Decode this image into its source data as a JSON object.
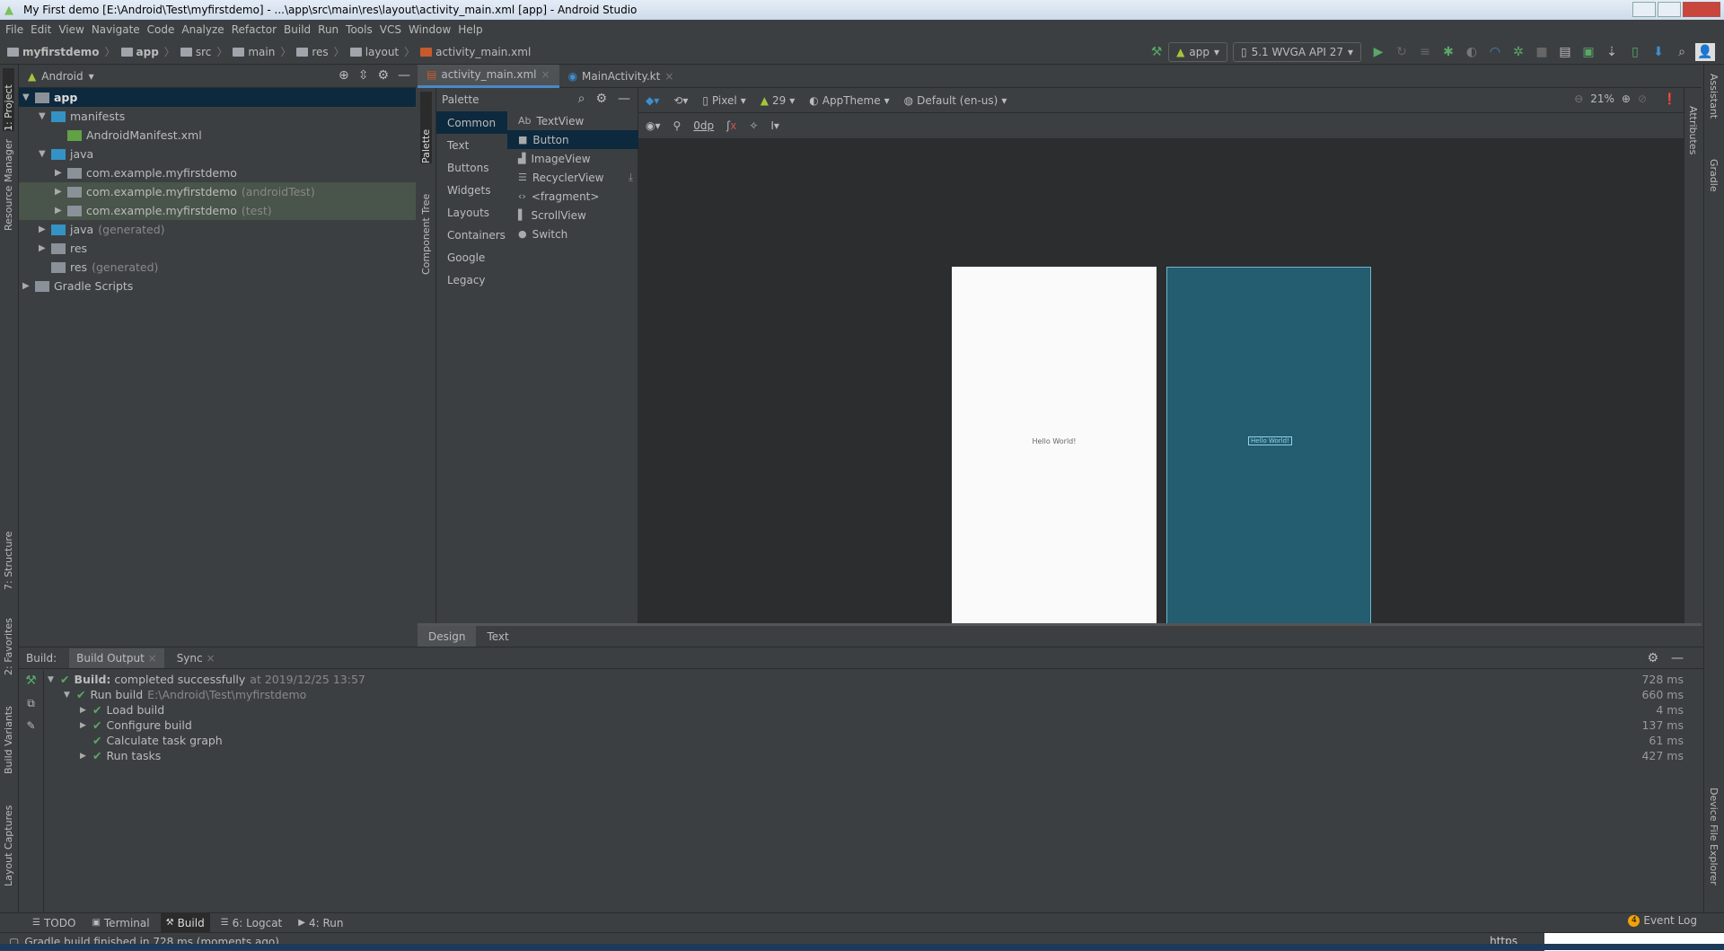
{
  "window": {
    "title": "My First demo [E:\\Android\\Test\\myfirstdemo] - ...\\app\\src\\main\\res\\layout\\activity_main.xml [app] - Android Studio"
  },
  "menu": [
    "File",
    "Edit",
    "View",
    "Navigate",
    "Code",
    "Analyze",
    "Refactor",
    "Build",
    "Run",
    "Tools",
    "VCS",
    "Window",
    "Help"
  ],
  "breadcrumb": [
    "myfirstdemo",
    "app",
    "src",
    "main",
    "res",
    "layout",
    "activity_main.xml"
  ],
  "toolbar": {
    "config": "app",
    "device": "5.1  WVGA API 27"
  },
  "left_strip": [
    "1: Project",
    "Resource Manager",
    "7: Structure",
    "2: Favorites",
    "Build Variants",
    "Layout Captures"
  ],
  "right_strip": [
    "Assistant",
    "Gradle",
    "Device File Explorer"
  ],
  "project": {
    "view": "Android",
    "tree": [
      {
        "label": "app",
        "extra": "",
        "depth": 0,
        "arrow": "down",
        "icon": "module",
        "bold": true,
        "selected": true
      },
      {
        "label": "manifests",
        "extra": "",
        "depth": 1,
        "arrow": "down",
        "icon": "folder"
      },
      {
        "label": "AndroidManifest.xml",
        "extra": "",
        "depth": 2,
        "arrow": "",
        "icon": "manifest"
      },
      {
        "label": "java",
        "extra": "",
        "depth": 1,
        "arrow": "down",
        "icon": "folder"
      },
      {
        "label": "com.example.myfirstdemo",
        "extra": "",
        "depth": 2,
        "arrow": "right",
        "icon": "package"
      },
      {
        "label": "com.example.myfirstdemo",
        "extra": "(androidTest)",
        "depth": 2,
        "arrow": "right",
        "icon": "package",
        "highlight": true
      },
      {
        "label": "com.example.myfirstdemo",
        "extra": "(test)",
        "depth": 2,
        "arrow": "right",
        "icon": "package",
        "highlight": true
      },
      {
        "label": "java",
        "extra": "(generated)",
        "depth": 1,
        "arrow": "right",
        "icon": "folder-gen"
      },
      {
        "label": "res",
        "extra": "",
        "depth": 1,
        "arrow": "right",
        "icon": "res"
      },
      {
        "label": "res",
        "extra": "(generated)",
        "depth": 1,
        "arrow": "",
        "icon": "res"
      },
      {
        "label": "Gradle Scripts",
        "extra": "",
        "depth": 0,
        "arrow": "right",
        "icon": "gradle"
      }
    ]
  },
  "editor": {
    "tabs": [
      {
        "label": "activity_main.xml",
        "active": true
      },
      {
        "label": "MainActivity.kt",
        "active": false
      }
    ],
    "side_tabs": [
      "Palette",
      "Component Tree"
    ],
    "attributes_tab": "Attributes",
    "palette": {
      "title": "Palette",
      "categories": [
        "Common",
        "Text",
        "Buttons",
        "Widgets",
        "Layouts",
        "Containers",
        "Google",
        "Legacy"
      ],
      "selected_category": "Common",
      "items": [
        {
          "label": "TextView",
          "icon": "Ab"
        },
        {
          "label": "Button",
          "icon": "button"
        },
        {
          "label": "ImageView",
          "icon": "image"
        },
        {
          "label": "RecyclerView",
          "icon": "list"
        },
        {
          "label": "<fragment>",
          "icon": "code"
        },
        {
          "label": "ScrollView",
          "icon": "scroll"
        },
        {
          "label": "Switch",
          "icon": "switch"
        }
      ],
      "selected_item": "Button"
    },
    "design_toolbar": {
      "device": "Pixel",
      "api": "29",
      "theme": "AppTheme",
      "locale": "Default (en-us)",
      "zoom": "21%",
      "margin": "0dp"
    },
    "preview_text": "Hello World!",
    "blueprint_text": "Hello World!",
    "bottom_tabs": [
      "Design",
      "Text"
    ],
    "active_bottom_tab": "Design"
  },
  "build": {
    "label": "Build:",
    "tabs": [
      "Build Output",
      "Sync"
    ],
    "rows": [
      {
        "text": "Build:",
        "rest": " completed successfully",
        "extra": "at 2019/12/25 13:57",
        "time": "728 ms",
        "depth": 0,
        "arrow": "down"
      },
      {
        "text": "Run build",
        "rest": "",
        "extra": "E:\\Android\\Test\\myfirstdemo",
        "time": "660 ms",
        "depth": 1,
        "arrow": "down"
      },
      {
        "text": "Load build",
        "rest": "",
        "extra": "",
        "time": "4 ms",
        "depth": 2,
        "arrow": "right"
      },
      {
        "text": "Configure build",
        "rest": "",
        "extra": "",
        "time": "137 ms",
        "depth": 2,
        "arrow": "right"
      },
      {
        "text": "Calculate task graph",
        "rest": "",
        "extra": "",
        "time": "61 ms",
        "depth": 2,
        "arrow": ""
      },
      {
        "text": "Run tasks",
        "rest": "",
        "extra": "",
        "time": "427 ms",
        "depth": 2,
        "arrow": "right"
      }
    ]
  },
  "tool_tabs": [
    "TODO",
    "Terminal",
    "Build",
    "6: Logcat",
    "4: Run"
  ],
  "active_tool_tab": "Build",
  "event_log": {
    "label": "Event Log",
    "count": "4"
  },
  "status": {
    "text": "Gradle build finished in 728 ms (moments ago)",
    "right": "https"
  },
  "colors": {
    "accent": "#4a88c7",
    "success": "#59a869",
    "blueprint": "#245c70",
    "selection": "#0d293e"
  }
}
